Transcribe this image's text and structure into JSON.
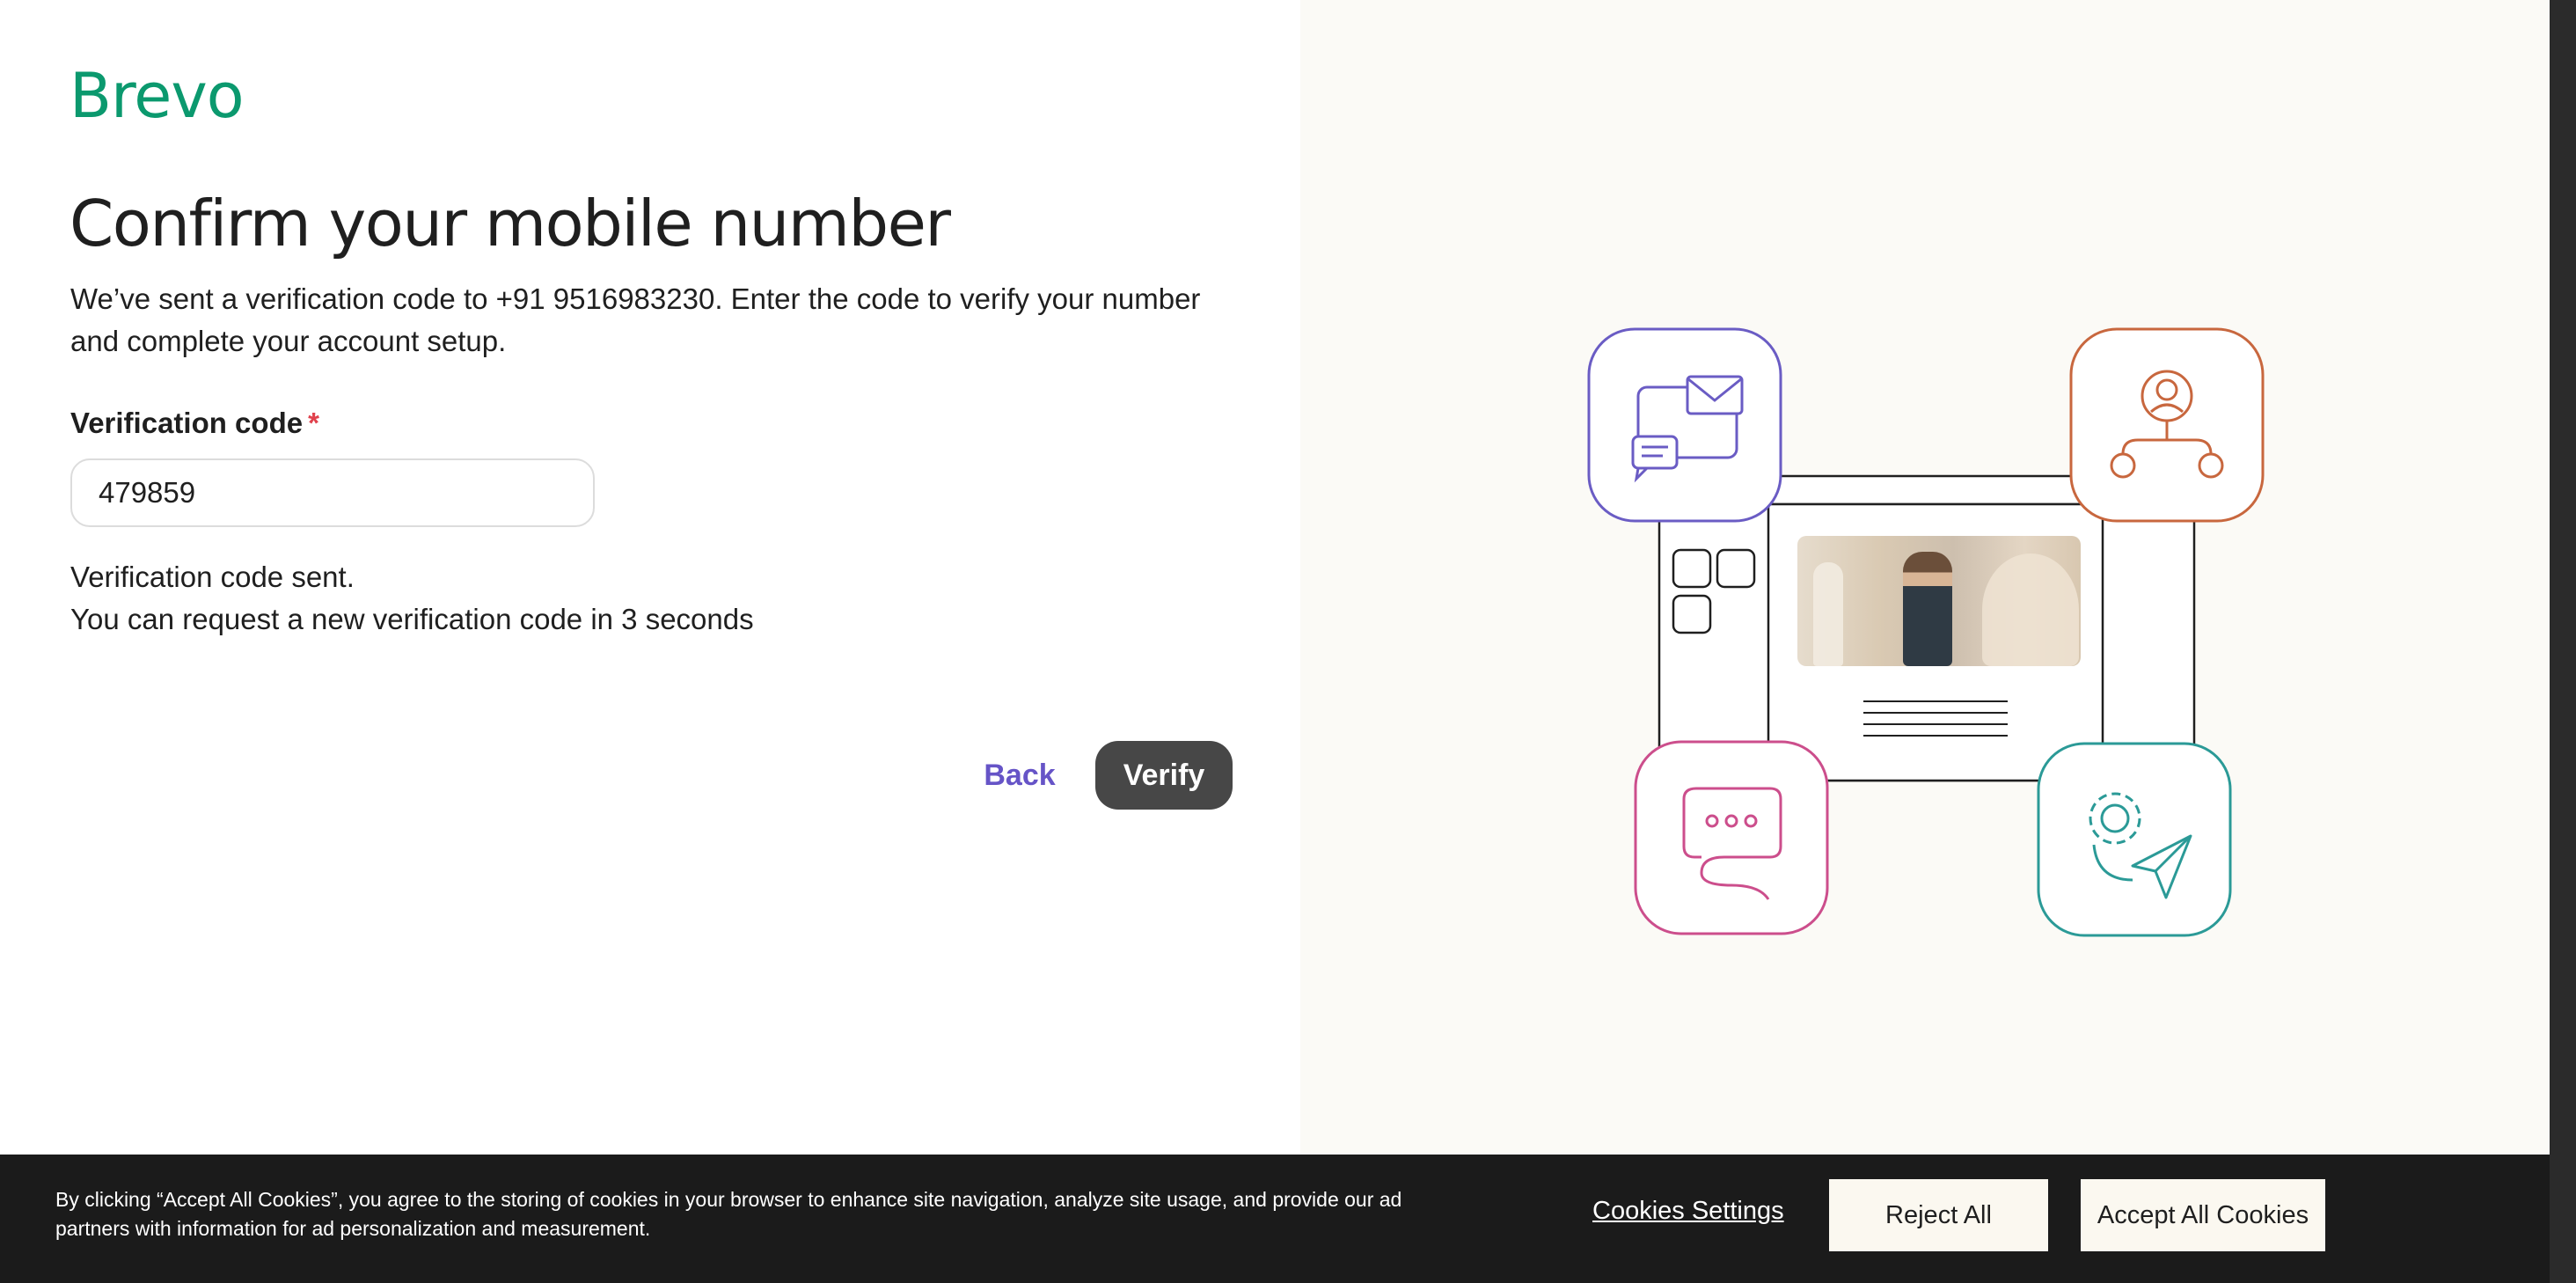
{
  "brand": {
    "logo_text": "Brevo",
    "color": "#0b996e"
  },
  "main": {
    "title": "Confirm your mobile number",
    "description": "We’ve sent a verification code to +91 9516983230. Enter the code to verify your number and complete your account setup.",
    "field": {
      "label": "Verification code",
      "required_marker": "*",
      "value": "479859"
    },
    "status_line_1": "Verification code sent.",
    "status_line_2": "You can request a new verification code in 3 seconds",
    "back_label": "Back",
    "verify_label": "Verify"
  },
  "illustration": {
    "icons": [
      "email-chat-icon",
      "user-network-icon",
      "speech-bubble-icon",
      "gear-send-icon"
    ],
    "colors": {
      "purple": "#6a5cc4",
      "orange": "#c8673e",
      "pink": "#cc4e8c",
      "teal": "#2b9a97"
    }
  },
  "cookie_banner": {
    "text": "By clicking “Accept All Cookies”, you agree to the storing of cookies in your browser to enhance site navigation, analyze site usage, and provide our ad partners with information for ad personalization and measurement.",
    "settings_label": "Cookies Settings",
    "reject_label": "Reject All",
    "accept_label": "Accept All Cookies"
  },
  "colors": {
    "accent": "#6654c7",
    "button_dark": "#474747",
    "required": "#e0424d"
  }
}
